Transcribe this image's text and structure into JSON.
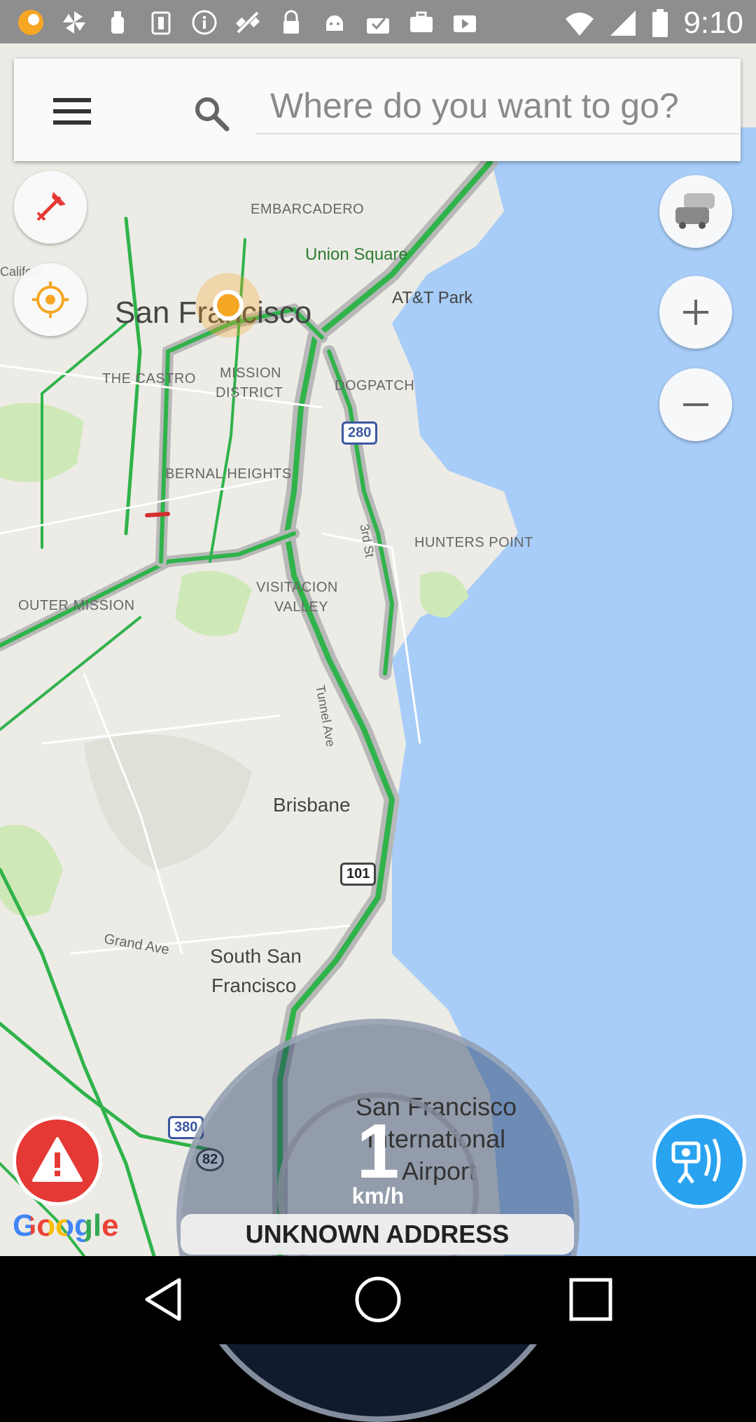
{
  "status_bar": {
    "time": "9:10",
    "icons": [
      "app-badge-icon",
      "pinwheel-icon",
      "bottle-icon",
      "bottle-alt-icon",
      "info-icon",
      "satellite-icon",
      "lock-icon",
      "android-icon",
      "clipboard-check-icon",
      "briefcase-icon",
      "play-store-icon"
    ]
  },
  "search": {
    "placeholder": "Where do you want to go?"
  },
  "map": {
    "labels": {
      "embarcadero": "EMBARCADERO",
      "union_square": "Union Square",
      "att_park": "AT&T Park",
      "san_francisco": "San Francisco",
      "the_castro": "THE CASTRO",
      "mission_district_1": "MISSION",
      "mission_district_2": "DISTRICT",
      "dogpatch": "DOGPATCH",
      "bernal_heights": "BERNAL HEIGHTS",
      "hunters_point": "HUNTERS POINT",
      "outer_mission": "OUTER MISSION",
      "visitacion_1": "VISITACION",
      "visitacion_2": "VALLEY",
      "third_st": "3rd St",
      "tunnel_ave": "Tunnel Ave",
      "brisbane": "Brisbane",
      "grand_ave": "Grand Ave",
      "south_sf_1": "South San",
      "south_sf_2": "Francisco",
      "sfo_1": "San Francisco",
      "sfo_2": "International",
      "sfo_3": "Airport",
      "california": "Californ"
    },
    "shields": {
      "i280": "280",
      "us101": "101",
      "i380": "380",
      "ca82": "82"
    }
  },
  "speedometer": {
    "value": "1",
    "unit": "km/h"
  },
  "address": "UNKNOWN ADDRESS",
  "google_logo": "Google",
  "colors": {
    "accent_blue": "#29a3f0",
    "warn_red": "#e53935",
    "location_orange": "#f5a623",
    "traffic_green": "#2fb34a"
  }
}
